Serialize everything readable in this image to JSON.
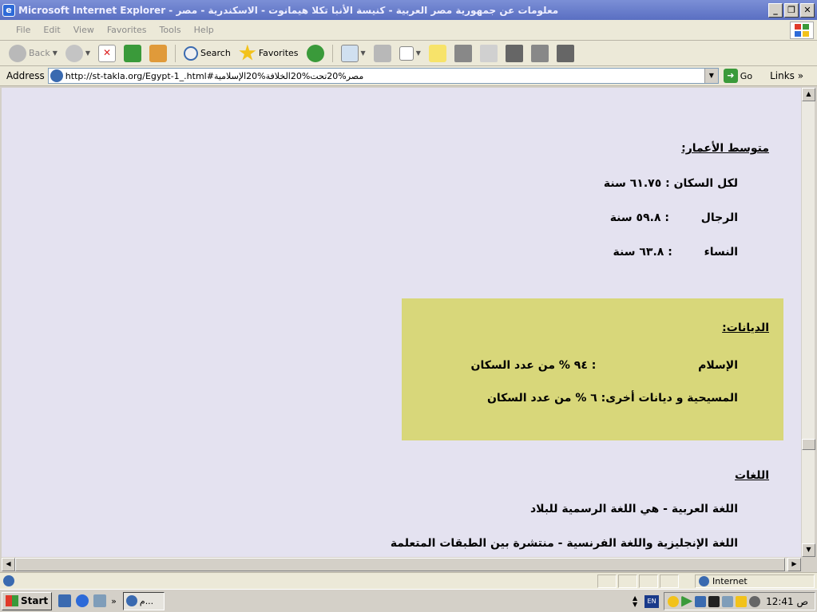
{
  "window": {
    "title": "معلومات عن جمهورية مصر العربية - كنيسة الأنبا تكلا هيمانوت - الاسكندرية - مصر - Microsoft Internet Explorer",
    "minimize": "_",
    "maximize": "❐",
    "close": "✕"
  },
  "menu": {
    "items": [
      "File",
      "Edit",
      "View",
      "Favorites",
      "Tools",
      "Help"
    ]
  },
  "toolbar": {
    "back": "Back",
    "search": "Search",
    "favorites": "Favorites"
  },
  "address": {
    "label": "Address",
    "url": "http://st-takla.org/Egypt-1_.html#مصر%20تحت%20الخلافة%20الإسلامية",
    "go": "Go",
    "links": "Links"
  },
  "content": {
    "age_heading": "متوسط الأعمار:",
    "age_all": "لكل السكان : ٦١.٧٥ سنة",
    "age_men_label": "الرجال",
    "age_men_value": ": ٥٩.٨ سنة",
    "age_women_label": "النساء",
    "age_women_value": ": ٦٣.٨ سنة",
    "religions_heading": "الديانات:",
    "islam_label": "الإسلام",
    "islam_value": ": ٩٤ % من عدد السكان",
    "christian_label": "المسيحية و ديانات أخرى:",
    "christian_value": "٦ % من عدد السكان",
    "languages_heading": "اللغات",
    "lang_arabic": "اللغة العربية - هي اللغة الرسمية للبلاد",
    "lang_other": "اللغة الإنجليزية واللغة الفرنسية - منتشرة بين الطبقات المتعلمة"
  },
  "status": {
    "zone": "Internet"
  },
  "taskbar": {
    "start": "Start",
    "task_label": "م...",
    "lang": "EN",
    "clock": "12:41 ص"
  },
  "colors": {
    "page_background": "#e4e2f0",
    "highlight_box": "#d8d77a"
  }
}
